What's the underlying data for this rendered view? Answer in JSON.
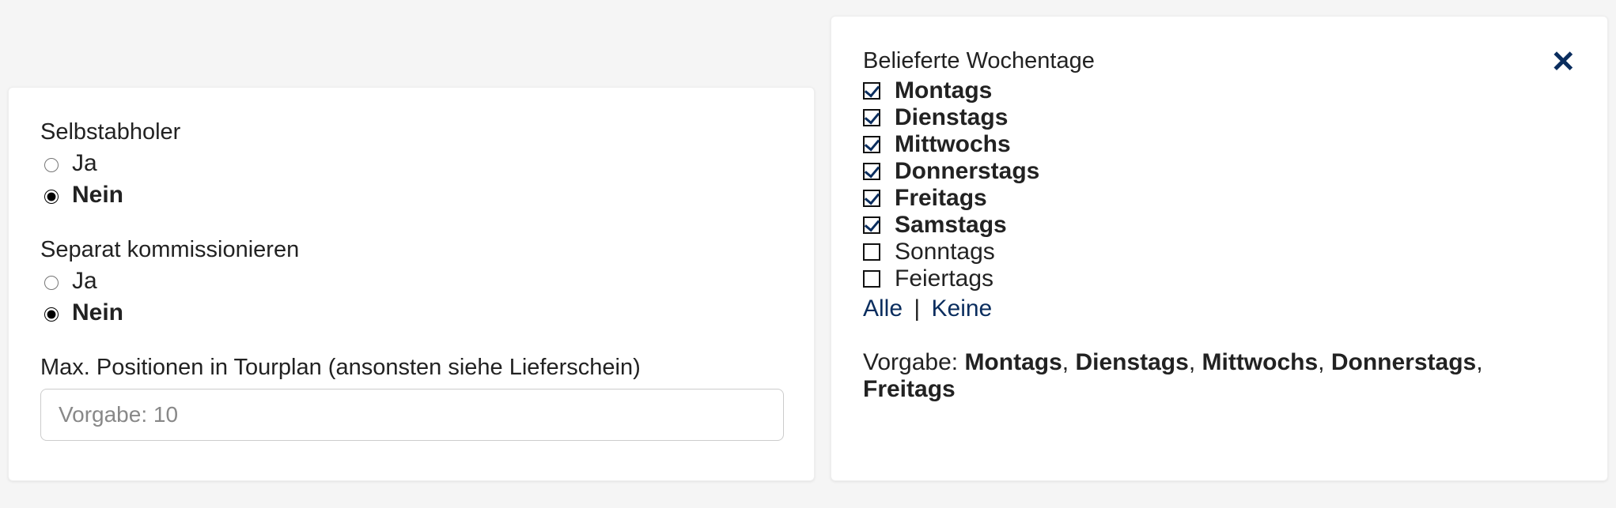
{
  "left": {
    "selbstabholer": {
      "label": "Selbstabholer",
      "yes": "Ja",
      "no": "Nein",
      "selected": "no"
    },
    "separat": {
      "label": "Separat kommissionieren",
      "yes": "Ja",
      "no": "Nein",
      "selected": "no"
    },
    "maxpos": {
      "label": "Max. Positionen in Tourplan (ansonsten siehe Lieferschein)",
      "placeholder": "Vorgabe: 10",
      "value": ""
    }
  },
  "right": {
    "title": "Belieferte Wochentage",
    "days": [
      {
        "label": "Montags",
        "checked": true
      },
      {
        "label": "Dienstags",
        "checked": true
      },
      {
        "label": "Mittwochs",
        "checked": true
      },
      {
        "label": "Donnerstags",
        "checked": true
      },
      {
        "label": "Freitags",
        "checked": true
      },
      {
        "label": "Samstags",
        "checked": true
      },
      {
        "label": "Sonntags",
        "checked": false
      },
      {
        "label": "Feiertags",
        "checked": false
      }
    ],
    "select_all": "Alle",
    "select_none": "Keine",
    "default_prefix": "Vorgabe: ",
    "default_days": [
      "Montags",
      "Dienstags",
      "Mittwochs",
      "Donnerstags",
      "Freitags"
    ]
  }
}
